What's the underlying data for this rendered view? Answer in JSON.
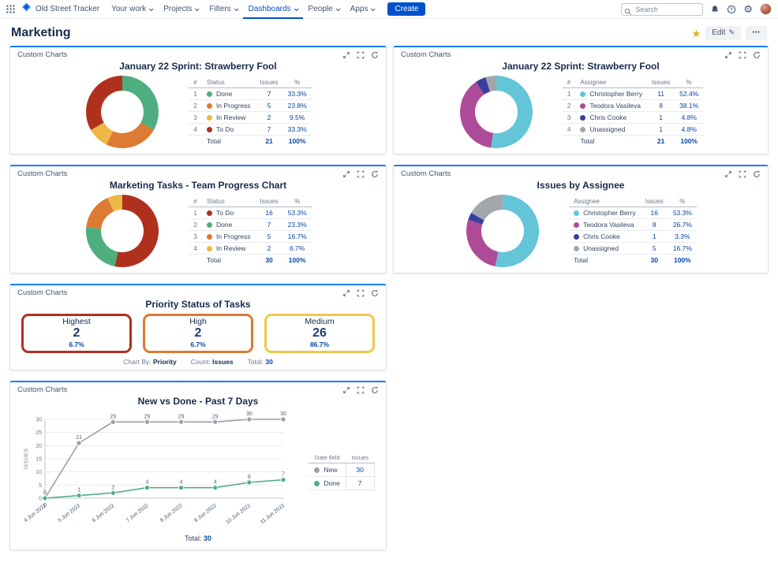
{
  "theme": {
    "accent": "#0052CC",
    "gadget_top_border": "#1D7AFC",
    "link_blue": "#0747A6",
    "star_yellow": "#E2B203"
  },
  "nav": {
    "app_name": "Old Street Tracker",
    "menus": [
      "Your work",
      "Projects",
      "Filters",
      "Dashboards",
      "People",
      "Apps"
    ],
    "active_menu": "Dashboards",
    "create_label": "Create",
    "search_placeholder": "Search"
  },
  "page": {
    "title": "Marketing",
    "edit_label": "Edit",
    "gadget_title": "Custom Charts"
  },
  "chart_data": [
    {
      "type": "pie",
      "title": "January 22 Sprint: Strawberry Fool",
      "columns": [
        "#",
        "Status",
        "Issues",
        "%"
      ],
      "show_index": true,
      "rows": [
        {
          "label": "Done",
          "issues": 7,
          "pct": "33.3%",
          "color": "#4FAE7F"
        },
        {
          "label": "In Progress",
          "issues": 5,
          "pct": "23.8%",
          "color": "#DD7A33"
        },
        {
          "label": "In Review",
          "issues": 2,
          "pct": "9.5%",
          "color": "#EDB843"
        },
        {
          "label": "To Do",
          "issues": 7,
          "pct": "33.3%",
          "color": "#B0301E"
        }
      ],
      "total_label": "Total",
      "total": 21,
      "total_pct": "100%"
    },
    {
      "type": "pie",
      "title": "January 22 Sprint: Strawberry Fool",
      "columns": [
        "#",
        "Assignee",
        "Issues",
        "%"
      ],
      "show_index": true,
      "rows": [
        {
          "label": "Christopher Berry",
          "issues": 11,
          "pct": "52.4%",
          "color": "#64C5D8"
        },
        {
          "label": "Teodora Vasileva",
          "issues": 8,
          "pct": "38.1%",
          "color": "#AD4B98"
        },
        {
          "label": "Chris Cooke",
          "issues": 1,
          "pct": "4.8%",
          "color": "#3A3E9C"
        },
        {
          "label": "Unassigned",
          "issues": 1,
          "pct": "4.8%",
          "color": "#A2A7AC"
        }
      ],
      "total_label": "Total",
      "total": 21,
      "total_pct": "100%"
    },
    {
      "type": "pie",
      "title": "Marketing Tasks - Team Progress Chart",
      "columns": [
        "#",
        "Status",
        "Issues",
        "%"
      ],
      "show_index": true,
      "rows": [
        {
          "label": "To Do",
          "issues": 16,
          "pct": "53.3%",
          "color": "#B0301E"
        },
        {
          "label": "Done",
          "issues": 7,
          "pct": "23.3%",
          "color": "#4FAE7F"
        },
        {
          "label": "In Progress",
          "issues": 5,
          "pct": "16.7%",
          "color": "#DD7A33"
        },
        {
          "label": "In Review",
          "issues": 2,
          "pct": "6.7%",
          "color": "#EDB843"
        }
      ],
      "total_label": "Total",
      "total": 30,
      "total_pct": "100%"
    },
    {
      "type": "pie",
      "title": "Issues by Assignee",
      "columns": [
        "Assignee",
        "Issues",
        "%"
      ],
      "show_index": false,
      "rows": [
        {
          "label": "Christopher Berry",
          "issues": 16,
          "pct": "53.3%",
          "color": "#64C5D8"
        },
        {
          "label": "Teodora Vasileva",
          "issues": 8,
          "pct": "26.7%",
          "color": "#AD4B98"
        },
        {
          "label": "Chris Cooke",
          "issues": 1,
          "pct": "3.3%",
          "color": "#3A3E9C"
        },
        {
          "label": "Unassigned",
          "issues": 5,
          "pct": "16.7%",
          "color": "#A2A7AC"
        }
      ],
      "total_label": "Total",
      "total": 30,
      "total_pct": "100%"
    },
    {
      "type": "stat-cards",
      "title": "Priority Status of Tasks",
      "cards": [
        {
          "label": "Highest",
          "value": "2",
          "pct": "6.7%",
          "color": "#B0301E"
        },
        {
          "label": "High",
          "value": "2",
          "pct": "6.7%",
          "color": "#DD7A33"
        },
        {
          "label": "Medium",
          "value": "26",
          "pct": "86.7%",
          "color": "#EDC94C"
        }
      ],
      "footer": [
        {
          "label": "Chart By:",
          "value": "Priority"
        },
        {
          "label": "Count:",
          "value": "Issues"
        },
        {
          "label": "Total:",
          "value": "30",
          "accent": true
        }
      ]
    },
    {
      "type": "line",
      "title": "New vs Done - Past 7 Days",
      "x": [
        "4 Jun 2022",
        "5 Jun 2022",
        "6 Jun 2022",
        "7 Jun 2022",
        "8 Jun 2022",
        "9 Jun 2022",
        "10 Jun 2022",
        "11 Jun 2022"
      ],
      "series": [
        {
          "name": "New",
          "color": "#9BA0A6",
          "values": [
            0,
            21,
            29,
            29,
            29,
            29,
            30,
            30
          ],
          "total": "30"
        },
        {
          "name": "Done",
          "color": "#4FAE7F",
          "values": [
            0,
            1,
            2,
            4,
            4,
            4,
            6,
            7
          ],
          "total": "7"
        }
      ],
      "ylabel": "ISSUES",
      "ylim": [
        0,
        30
      ],
      "yticks": [
        0,
        5,
        10,
        15,
        20,
        25,
        30
      ],
      "grid": true,
      "legend_columns": [
        "Date field",
        "Issues"
      ],
      "legend_position": "right",
      "footer_label": "Total:",
      "footer_value": "30"
    }
  ]
}
